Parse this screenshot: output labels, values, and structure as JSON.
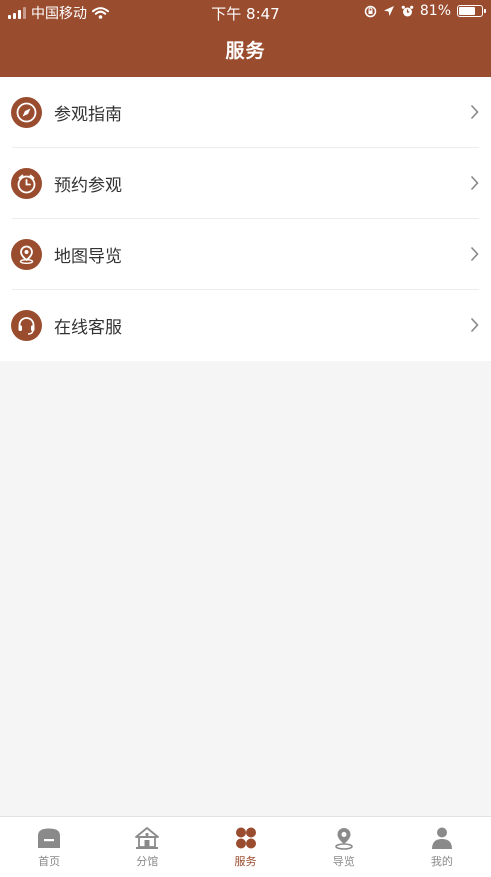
{
  "status_bar": {
    "carrier": "中国移动",
    "time": "下午 8:47",
    "battery_percent": "81%",
    "battery_level": 0.81,
    "icons": [
      "signal-icon",
      "wifi-icon",
      "orientation-lock-icon",
      "location-icon",
      "alarm-icon",
      "battery-icon"
    ]
  },
  "header": {
    "title": "服务"
  },
  "menu": {
    "items": [
      {
        "label": "参观指南",
        "icon": "compass-icon"
      },
      {
        "label": "预约参观",
        "icon": "alarm-clock-icon"
      },
      {
        "label": "地图导览",
        "icon": "map-pin-icon"
      },
      {
        "label": "在线客服",
        "icon": "headset-icon"
      }
    ]
  },
  "tabbar": {
    "items": [
      {
        "label": "首页",
        "icon": "home-icon"
      },
      {
        "label": "分馆",
        "icon": "building-icon"
      },
      {
        "label": "服务",
        "icon": "clover-icon",
        "active": true
      },
      {
        "label": "导览",
        "icon": "map-pin-icon"
      },
      {
        "label": "我的",
        "icon": "user-icon"
      }
    ]
  },
  "colors": {
    "brand": "#9a4c2f",
    "tab_inactive": "#8a8a8a",
    "background": "#f5f5f5"
  }
}
